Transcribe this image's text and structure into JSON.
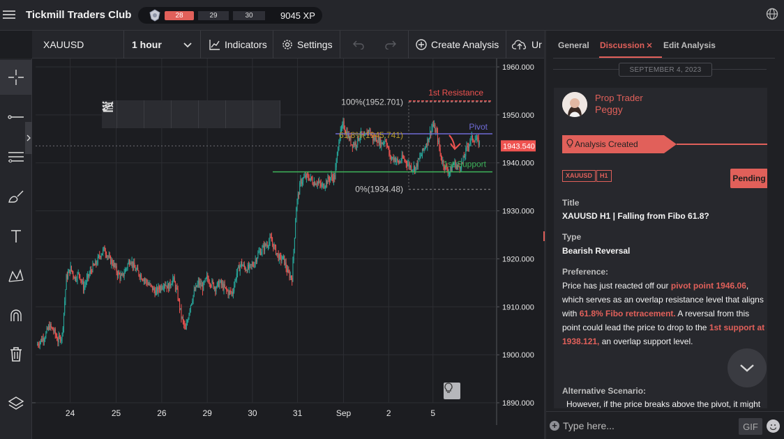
{
  "app": {
    "title": "Tickmill Traders Club",
    "xp_levels": [
      "28",
      "29",
      "30"
    ],
    "xp_text": "9045 XP"
  },
  "toolbar": {
    "symbol": "XAUUSD",
    "interval": "1 hour",
    "indicators": "Indicators",
    "settings": "Settings",
    "create_analysis": "Create Analysis",
    "upload": "Ur"
  },
  "left_tools": [
    "crosshair-tool",
    "line-tool",
    "multi-line-tool",
    "brush-tool",
    "text-tool",
    "pattern-tool",
    "magnet-tool",
    "trash-tool",
    "layers-tool"
  ],
  "chart_data": {
    "type": "candlestick",
    "symbol": "XAUUSD",
    "interval": "1 hour",
    "x_tick_labels": [
      "24",
      "25",
      "26",
      "29",
      "30",
      "31",
      "Sep",
      "2",
      "5"
    ],
    "y_tick_labels": [
      "1960.000",
      "1950.000",
      "1940.000",
      "1930.000",
      "1920.000",
      "1910.000",
      "1900.000",
      "1890.000"
    ],
    "ylim": [
      1890,
      1960
    ],
    "current_price": "1943.540",
    "grid": true,
    "annotations": {
      "resistance_label": "1st Resistance",
      "resistance_value": 1952.9,
      "pivot_label": "Pivot",
      "pivot_value": 1946.06,
      "support_label": "1st Support",
      "support_value": 1938.121,
      "fib_100": "100%(1952.701)",
      "fib_100_value": 1952.701,
      "fib_618": "61.8%(1945.741)",
      "fib_618_value": 1945.741,
      "fib_0": "0%(1934.48)",
      "fib_0_value": 1934.48
    },
    "price_path": [
      1902,
      1903,
      1904,
      1906,
      1905,
      1903,
      1904,
      1916,
      1918,
      1916,
      1917,
      1914,
      1916,
      1918,
      1919,
      1921,
      1922,
      1920,
      1919,
      1917,
      1916,
      1918,
      1920,
      1918,
      1917,
      1916,
      1915,
      1914,
      1913,
      1914,
      1915,
      1914,
      1916,
      1913,
      1908,
      1905,
      1910,
      1913,
      1915,
      1914,
      1916,
      1915,
      1914,
      1915,
      1914,
      1913,
      1913,
      1917,
      1919,
      1918,
      1918,
      1919,
      1921,
      1922,
      1923,
      1924,
      1922,
      1920,
      1920,
      1917,
      1916,
      1931,
      1936,
      1937,
      1937,
      1936,
      1936,
      1935,
      1936,
      1937,
      1937,
      1945,
      1948,
      1946,
      1944,
      1944,
      1946,
      1945,
      1947,
      1945,
      1945,
      1944,
      1945,
      1941,
      1941,
      1940,
      1941,
      1940,
      1939,
      1939,
      1941,
      1943,
      1945,
      1948,
      1946,
      1941,
      1939,
      1938,
      1940,
      1939,
      1940,
      1943,
      1945,
      1945,
      1944
    ]
  },
  "panel": {
    "tabs": [
      "General",
      "Discussion",
      "Edit Analysis"
    ],
    "active_tab": "Discussion",
    "date": "SEPTEMBER 4, 2023",
    "author_role": "Prop Trader",
    "author_name": "Peggy",
    "status_ribbon": "Analysis Created",
    "tags": [
      "XAUUSD",
      "H1"
    ],
    "status": "Pending",
    "title_label": "Title",
    "title_value": "XAUUSD H1 | Falling from Fibo 61.8?",
    "type_label": "Type",
    "type_value": "Bearish Reversal",
    "preference_label": "Preference:",
    "preference_parts": [
      {
        "t": "Price has just reacted off our ",
        "hl": false
      },
      {
        "t": "pivot point 1946.06",
        "hl": true
      },
      {
        "t": ", which serves as an overlap resistance level that aligns with ",
        "hl": false
      },
      {
        "t": "61.8% Fibo retracement.",
        "hl": true
      },
      {
        "t": "  A reversal from this point could lead the price to drop to the ",
        "hl": false
      },
      {
        "t": "1st support at 1938.121,",
        "hl": true
      },
      {
        "t": " an overlap support level.",
        "hl": false
      }
    ],
    "alt_label": "Alternative Scenario:",
    "alt_text": "However, if the price breaks above the pivot, it might",
    "composer_placeholder": "Type here...",
    "gif_label": "GIF"
  },
  "colors": {
    "accent": "#e1605a",
    "up": "#26a69a",
    "down": "#ef5350",
    "pivot": "#6f6bd6",
    "support": "#3db35a"
  }
}
